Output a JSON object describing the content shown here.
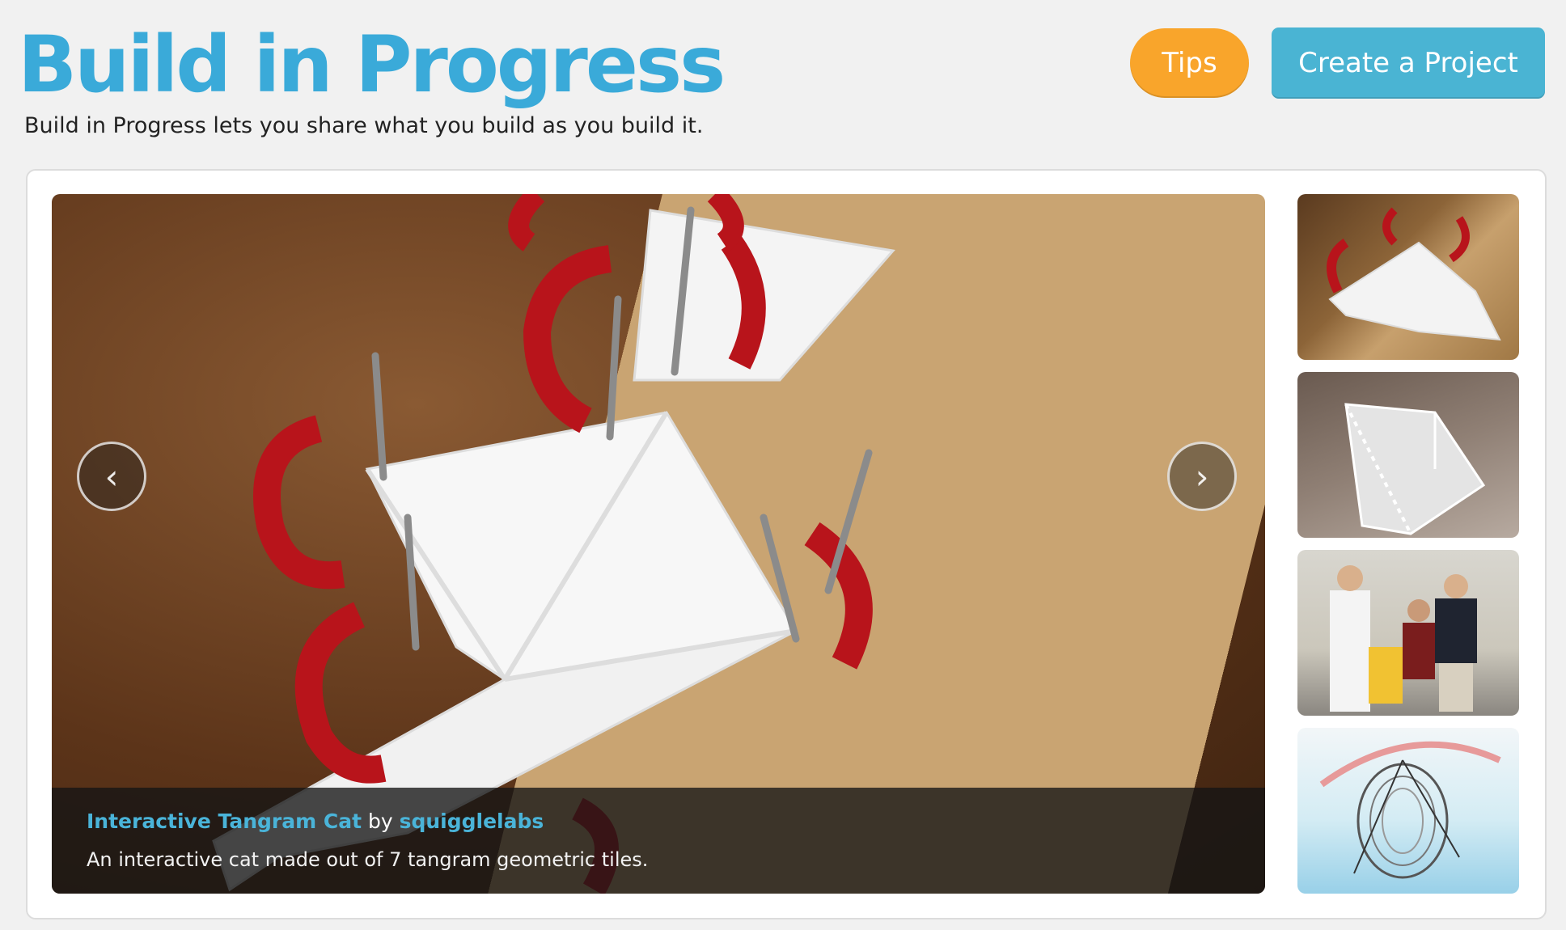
{
  "header": {
    "title": "Build in Progress",
    "tagline": "Build in Progress lets you share what you build as you build it.",
    "tips_label": "Tips",
    "create_label": "Create a Project"
  },
  "featured": {
    "project_title": "Interactive Tangram Cat",
    "by_text": "by",
    "author": "squigglelabs",
    "description": "An interactive cat made out of 7 tangram geometric tiles.",
    "prev_glyph": "‹",
    "next_glyph": "›"
  },
  "thumbnails": [
    {
      "name": "tangram-clamps"
    },
    {
      "name": "folded-acrylic"
    },
    {
      "name": "team-photo"
    },
    {
      "name": "3d-model"
    }
  ],
  "colors": {
    "brand_blue": "#3aaad9",
    "tips_orange": "#f9a52b",
    "create_blue": "#4ab4d3",
    "link_blue": "#4ab4d9"
  }
}
